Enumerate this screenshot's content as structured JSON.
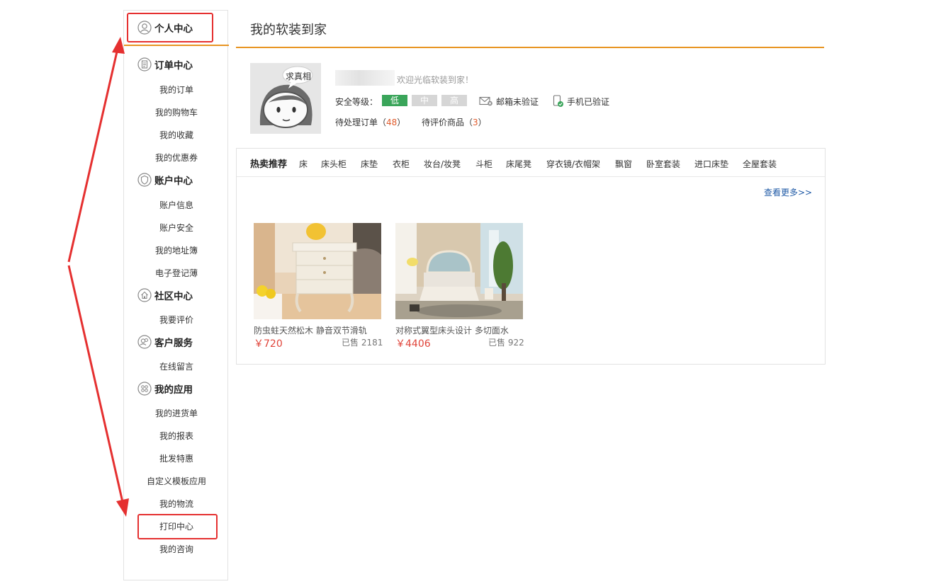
{
  "sidebar": {
    "top": {
      "label": "个人中心",
      "icon": "person-icon"
    },
    "sections": [
      {
        "label": "订单中心",
        "icon": "document-icon",
        "items": [
          "我的订单",
          "我的购物车",
          "我的收藏",
          "我的优惠券"
        ]
      },
      {
        "label": "账户中心",
        "icon": "shield-icon",
        "items": [
          "账户信息",
          "账户安全",
          "我的地址簿",
          "电子登记薄"
        ]
      },
      {
        "label": "社区中心",
        "icon": "home-icon",
        "items": [
          "我要评价"
        ]
      },
      {
        "label": "客户服务",
        "icon": "service-icon",
        "items": [
          "在线留言"
        ]
      },
      {
        "label": "我的应用",
        "icon": "apps-icon",
        "items": [
          "我的进货单",
          "我的报表",
          "批发特惠",
          "自定义模板应用",
          "我的物流",
          "打印中心",
          "我的咨询"
        ]
      }
    ]
  },
  "main": {
    "title": "我的软装到家",
    "profile": {
      "avatar_caption": "求真相",
      "welcome": "欢迎光临软装到家！",
      "security_label": "安全等级：",
      "levels": [
        "低",
        "中",
        "高"
      ],
      "level_colors": [
        "#3aa55a",
        "#d6d6d6",
        "#d6d6d6"
      ],
      "email_status": "邮箱未验证",
      "phone_status": "手机已验证",
      "pending_orders_label": "待处理订单（",
      "pending_orders": "48",
      "pending_reviews_label": "待评价商品（",
      "pending_reviews": "3",
      "close_paren": "）"
    },
    "hot": {
      "title": "热卖推荐",
      "categories": [
        "床",
        "床头柜",
        "床垫",
        "衣柜",
        "妆台/妆凳",
        "斗柜",
        "床尾凳",
        "穿衣镜/衣帽架",
        "飘窗",
        "卧室套装",
        "进口床垫",
        "全屋套装"
      ],
      "see_more": "查看更多>>",
      "products": [
        {
          "name": "防虫蛀天然松木 静音双节滑轨",
          "price": "￥720",
          "sold": "已售 2181"
        },
        {
          "name": "对称式翼型床头设计 多切面水",
          "price": "￥4406",
          "sold": "已售 922"
        }
      ]
    }
  },
  "colors": {
    "accent": "#e89422",
    "highlight": "#e53030",
    "price": "#e0443a",
    "link": "#1f5aa6"
  }
}
